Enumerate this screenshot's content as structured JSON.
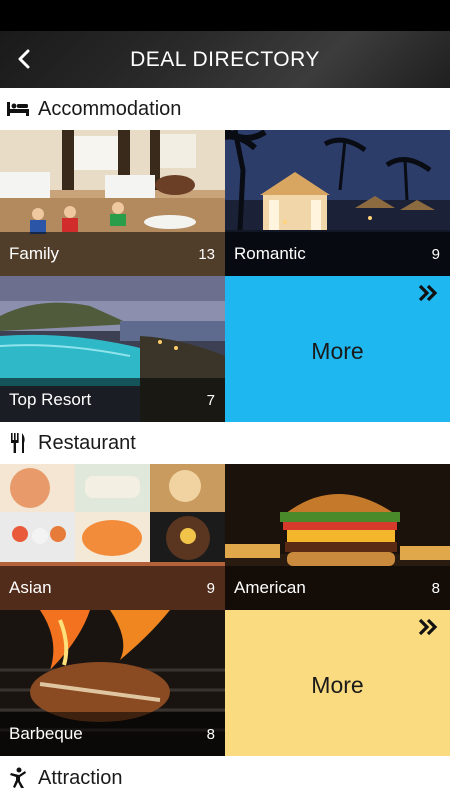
{
  "header": {
    "title": "DEAL DIRECTORY",
    "back_icon": "chevron-left-icon"
  },
  "sections": [
    {
      "label": "Accommodation",
      "icon": "bed-icon",
      "tiles": [
        {
          "name": "Family",
          "count": "13"
        },
        {
          "name": "Romantic",
          "count": "9"
        },
        {
          "name": "Top Resort",
          "count": "7"
        }
      ],
      "more": {
        "label": "More",
        "color": "#1EB7F0",
        "icon": "double-chevron-right-icon"
      }
    },
    {
      "label": "Restaurant",
      "icon": "fork-knife-icon",
      "tiles": [
        {
          "name": "Asian",
          "count": "9"
        },
        {
          "name": "American",
          "count": "8"
        },
        {
          "name": "Barbeque",
          "count": "8"
        }
      ],
      "more": {
        "label": "More",
        "color": "#FADB7F",
        "icon": "double-chevron-right-icon"
      }
    },
    {
      "label": "Attraction",
      "icon": "dancer-icon"
    }
  ]
}
